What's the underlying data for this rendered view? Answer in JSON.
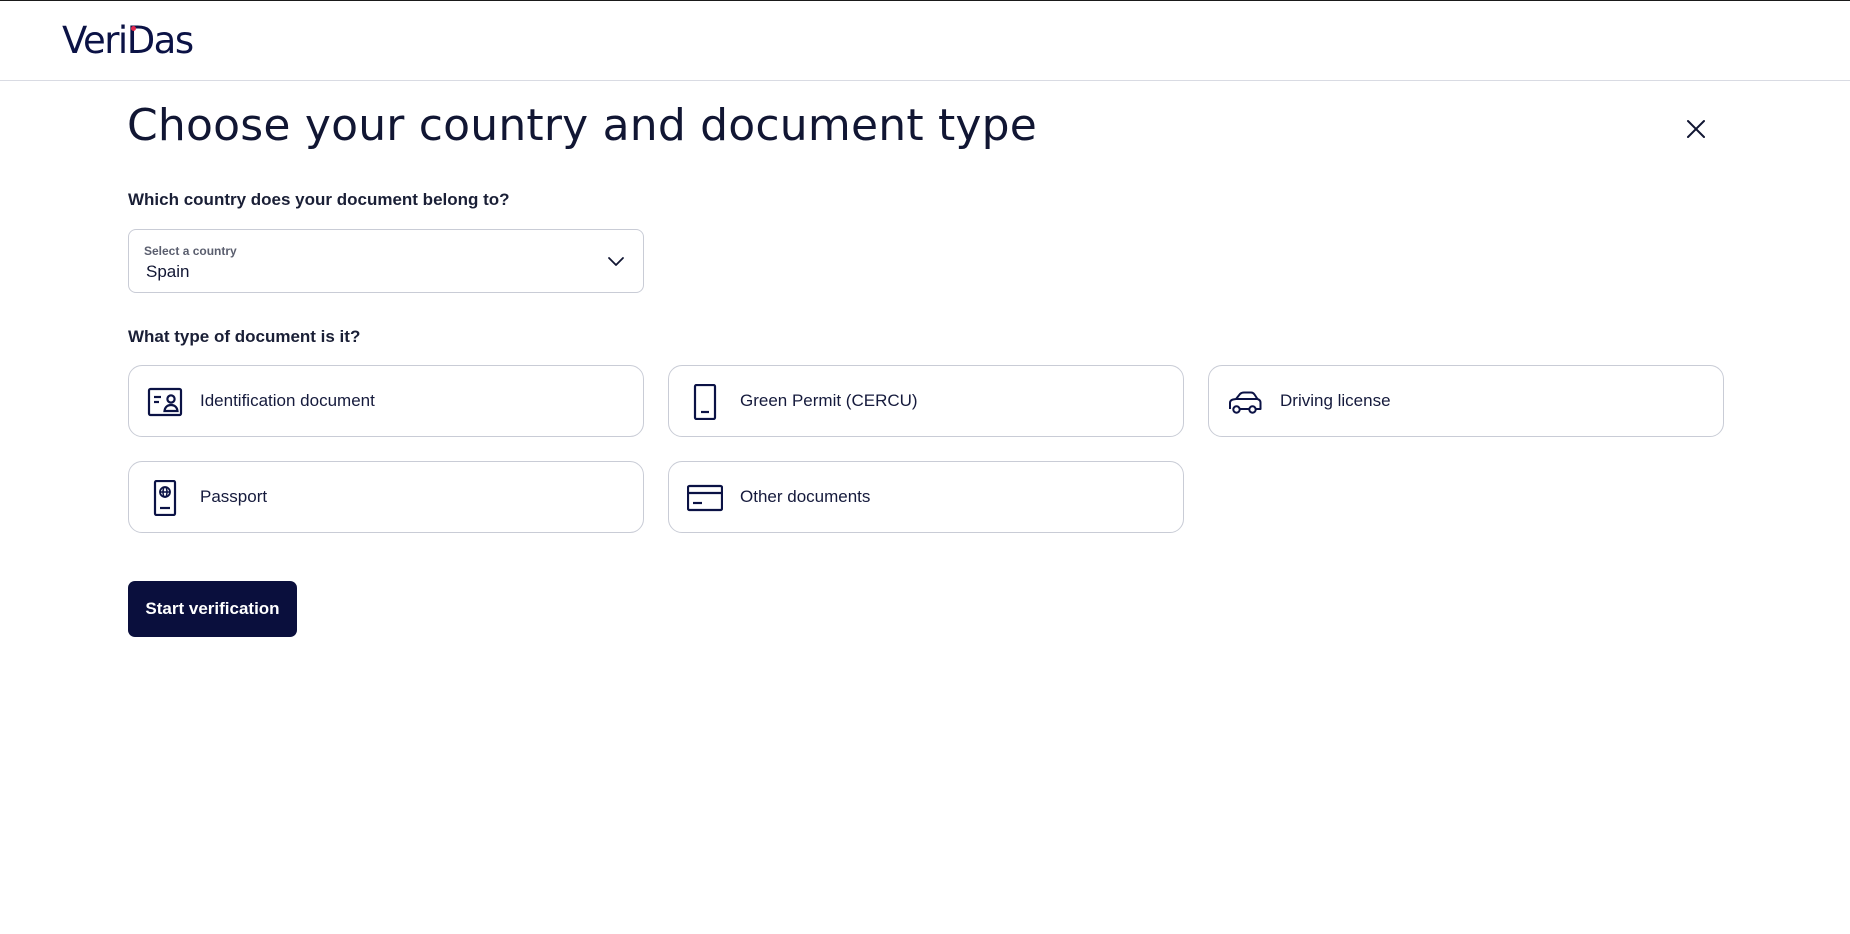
{
  "header": {
    "logo_text": "VeriDas"
  },
  "page": {
    "title": "Choose your country and document type",
    "close_icon": "close-icon"
  },
  "country": {
    "question": "Which country does your document belong to?",
    "select_hint": "Select a country",
    "selected_value": "Spain",
    "chevron_icon": "chevron-down-icon"
  },
  "document": {
    "question": "What type of document is it?",
    "options": [
      {
        "label": "Identification document",
        "icon": "id-card-icon"
      },
      {
        "label": "Green Permit (CERCU)",
        "icon": "green-permit-icon"
      },
      {
        "label": "Driving license",
        "icon": "car-icon"
      },
      {
        "label": "Passport",
        "icon": "passport-icon"
      },
      {
        "label": "Other documents",
        "icon": "credit-card-icon"
      }
    ]
  },
  "actions": {
    "start_label": "Start verification"
  },
  "colors": {
    "primary": "#0a0f3d",
    "border": "#c9ccd6",
    "logo_dot": "#e3264c"
  }
}
